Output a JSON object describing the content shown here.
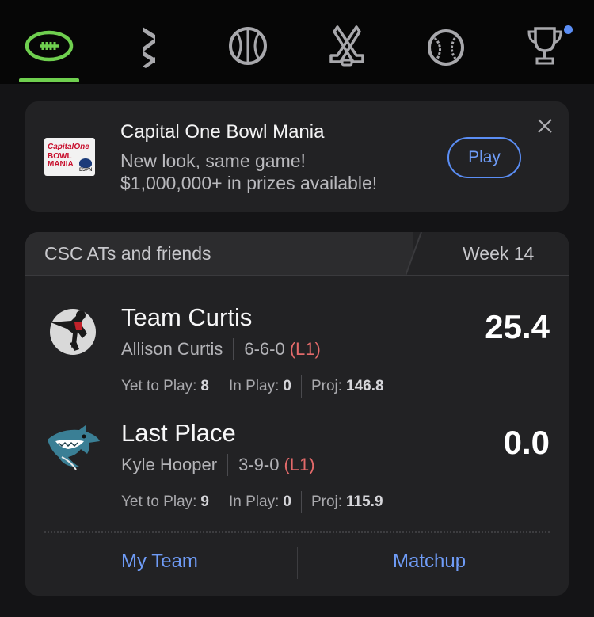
{
  "nav": {
    "items": [
      {
        "icon": "football-icon",
        "selected": true
      },
      {
        "icon": "espn-bet-icon"
      },
      {
        "icon": "basketball-icon"
      },
      {
        "icon": "hockey-icon"
      },
      {
        "icon": "baseball-icon"
      },
      {
        "icon": "trophy-icon",
        "notification": true
      }
    ],
    "accent_color": "#6fcf4f",
    "notification_color": "#5b8ef5"
  },
  "promo": {
    "logo_text_1": "Capital",
    "logo_text_2": "One",
    "logo_text_3": "BOWL",
    "logo_text_4": "MANIA",
    "logo_text_5": "ESPN",
    "title": "Capital One Bowl Mania",
    "line1": "New look, same game!",
    "line2": "$1,000,000+ in prizes available!",
    "play_label": "Play"
  },
  "league": {
    "name": "CSC ATs and friends",
    "week": "Week 14",
    "teams": [
      {
        "name": "Team Curtis",
        "owner": "Allison Curtis",
        "record": "6-6-0",
        "streak": "(L1)",
        "yet_to_play_label": "Yet to Play:",
        "yet_to_play": "8",
        "in_play_label": "In Play:",
        "in_play": "0",
        "proj_label": "Proj:",
        "proj": "146.8",
        "score": "25.4"
      },
      {
        "name": "Last Place",
        "owner": "Kyle Hooper",
        "record": "3-9-0",
        "streak": "(L1)",
        "yet_to_play_label": "Yet to Play:",
        "yet_to_play": "9",
        "in_play_label": "In Play:",
        "in_play": "0",
        "proj_label": "Proj:",
        "proj": "115.9",
        "score": "0.0"
      }
    ],
    "my_team_label": "My Team",
    "matchup_label": "Matchup"
  }
}
